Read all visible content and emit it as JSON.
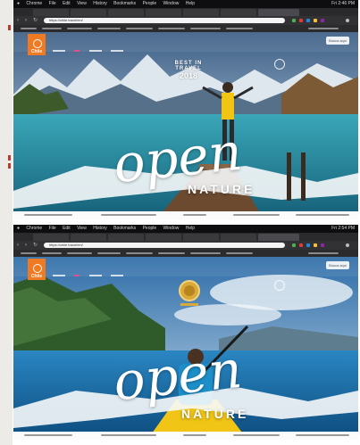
{
  "screenshots": [
    {
      "menubar": {
        "app": "Chrome",
        "items": [
          "File",
          "Edit",
          "View",
          "History",
          "Bookmarks",
          "People",
          "Window",
          "Help"
        ],
        "clock": "Fri 2:46 PM"
      },
      "address": {
        "url": "https://chile.travel/en/"
      },
      "site": {
        "logo_text": "Chile",
        "search_label": "Busca aqui",
        "award_line1": "BEST IN TRAVEL",
        "award_line2": "2018",
        "headline": "open",
        "subheadline": "NATURE"
      }
    },
    {
      "menubar": {
        "app": "Chrome",
        "items": [
          "File",
          "Edit",
          "View",
          "History",
          "Bookmarks",
          "People",
          "Window",
          "Help"
        ],
        "clock": "Fri 2:54 PM"
      },
      "address": {
        "url": "https://chile.travel/en/"
      },
      "site": {
        "logo_text": "Chile",
        "search_label": "Busca aqui",
        "headline": "open",
        "subheadline": "NATURE"
      }
    }
  ]
}
